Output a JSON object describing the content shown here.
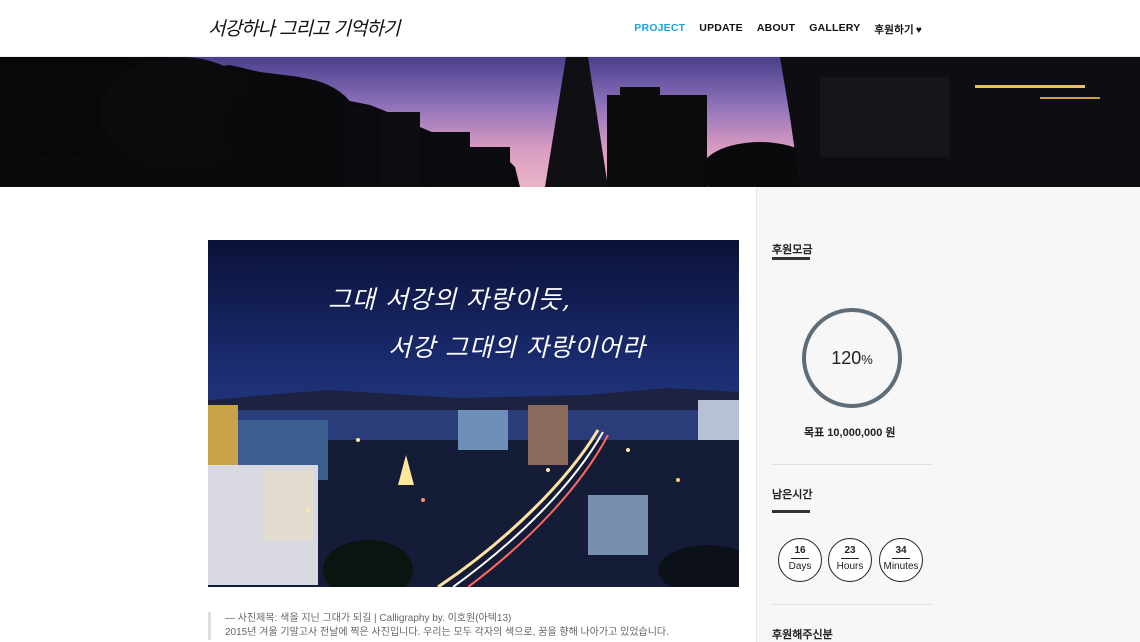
{
  "header": {
    "logo_text": "서강하나 그리고 기억하기",
    "nav": [
      {
        "label": "PROJECT",
        "active": true
      },
      {
        "label": "UPDATE",
        "active": false
      },
      {
        "label": "ABOUT",
        "active": false
      },
      {
        "label": "GALLERY",
        "active": false
      },
      {
        "label": "후원하기",
        "active": false
      }
    ],
    "donate_icon": "heart-icon"
  },
  "photo": {
    "calligraphy_line1": "그대 서강의 자랑이듯,",
    "calligraphy_line2": "서강 그대의 자랑이어라"
  },
  "caption": {
    "line1": "— 사진제목: 색을 지닌 그대가 되길 | Calligraphy by. 이호원(아텍13)",
    "line2": "2015년 겨울 기말고사 전날에 찍은 사진입니다. 우리는 모두 각자의 색으로, 꿈을 향해 나아가고 있었습니다."
  },
  "sidebar": {
    "funding_heading": "후원모금",
    "percent_value": "120",
    "percent_unit": "%",
    "goal_label": "목표 10,000,000 원",
    "time_heading": "남은시간",
    "timers": [
      {
        "value": "16",
        "unit": "Days"
      },
      {
        "value": "23",
        "unit": "Hours"
      },
      {
        "value": "34",
        "unit": "Minutes"
      }
    ],
    "sponsors_heading": "후원해주신분"
  },
  "colors": {
    "accent": "#1aa3d9",
    "ring": "#5f6d78",
    "sidebar_bg": "#f7f7f7"
  }
}
